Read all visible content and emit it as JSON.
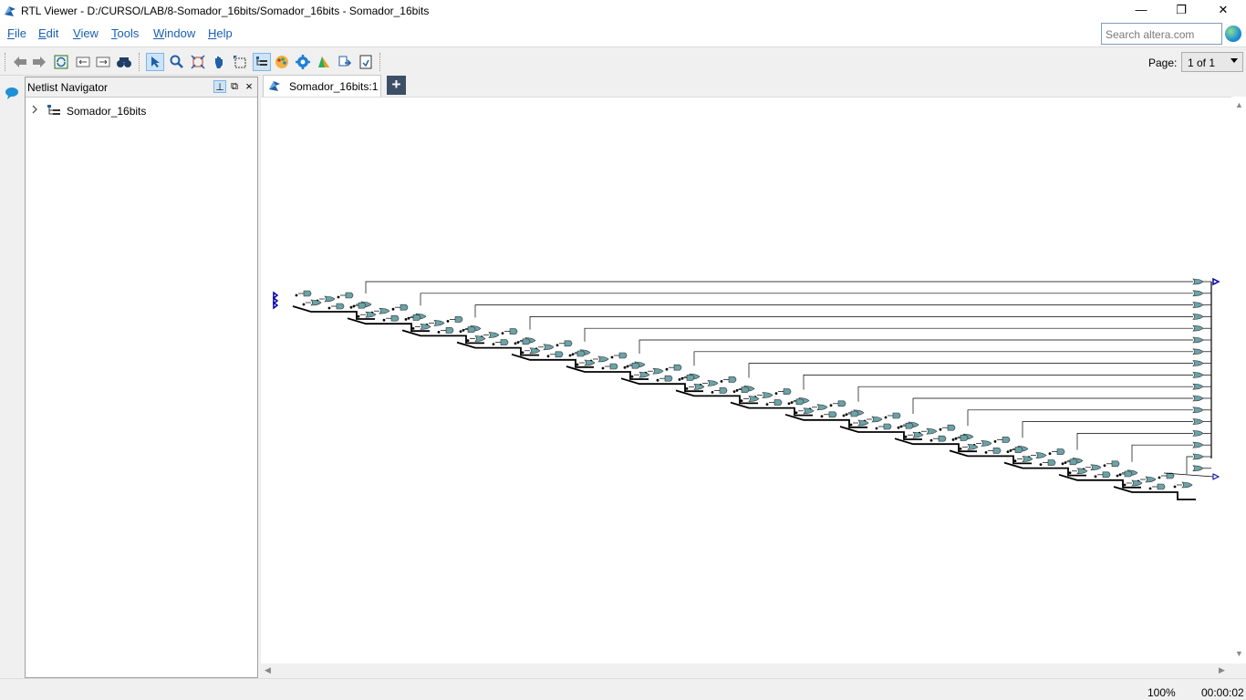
{
  "window": {
    "title": "RTL Viewer - D:/CURSO/LAB/8-Somador_16bits/Somador_16bits - Somador_16bits",
    "minimize_glyph": "—",
    "maximize_glyph": "❐",
    "close_glyph": "✕"
  },
  "menu": {
    "items": [
      {
        "accel": "F",
        "rest": "ile"
      },
      {
        "accel": "E",
        "rest": "dit"
      },
      {
        "accel": "V",
        "rest": "iew"
      },
      {
        "accel": "T",
        "rest": "ools"
      },
      {
        "accel": "W",
        "rest": "indow"
      },
      {
        "accel": "H",
        "rest": "elp"
      }
    ]
  },
  "search": {
    "placeholder": "Search altera.com"
  },
  "toolbar": {
    "page_label": "Page:",
    "page_value": "1 of 1",
    "icons": [
      "back-icon",
      "forward-icon",
      "refresh-icon",
      "collapse-icon",
      "expand-icon",
      "find-icon",
      "select-icon",
      "zoom-icon",
      "fit-icon",
      "hand-icon",
      "area-select-icon",
      "netlist-icon",
      "colors-icon",
      "settings-icon",
      "filter-icon",
      "export-icon",
      "save-icon"
    ]
  },
  "navigator": {
    "title": "Netlist Navigator",
    "pin_glyph": "⊥",
    "float_glyph": "⧉",
    "close_glyph": "×",
    "tree": [
      {
        "label": "Somador_16bits",
        "expanded": false
      }
    ]
  },
  "tabs": [
    {
      "label": "Somador_16bits:1",
      "active": true
    }
  ],
  "add_tab_glyph": "+",
  "schematic": {
    "module": "Somador_16bits",
    "stages": 16,
    "output_bits": 17,
    "gate_color": "#5f9ea0"
  },
  "status": {
    "zoom": "100%",
    "elapsed": "00:00:02"
  },
  "colors": {
    "accent": "#1a5fb4",
    "tab_add_bg": "#3c4f66",
    "gate_fill": "#6aa3a8",
    "wire": "#000000"
  }
}
